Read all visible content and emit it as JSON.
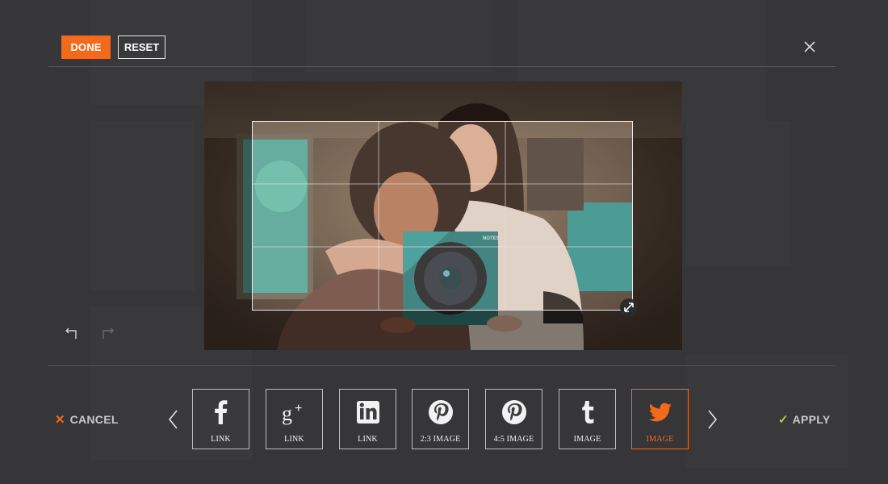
{
  "toolbar": {
    "done_label": "DONE",
    "reset_label": "RESET"
  },
  "icons": {
    "close": "close-icon",
    "undo": "undo-icon",
    "redo": "redo-icon",
    "resize": "resize-handle-icon",
    "prev": "chevron-left-icon",
    "next": "chevron-right-icon"
  },
  "editor": {
    "box_label": "NOTES"
  },
  "share": {
    "items": [
      {
        "label": "LINK",
        "icon": "facebook-icon"
      },
      {
        "label": "LINK",
        "icon": "google-plus-icon"
      },
      {
        "label": "LINK",
        "icon": "linkedin-icon"
      },
      {
        "label": "2:3 IMAGE",
        "icon": "pinterest-icon"
      },
      {
        "label": "4:5 IMAGE",
        "icon": "pinterest-icon"
      },
      {
        "label": "IMAGE",
        "icon": "tumblr-icon"
      },
      {
        "label": "IMAGE",
        "icon": "twitter-icon",
        "selected": true
      }
    ]
  },
  "footer": {
    "cancel_label": "CANCEL",
    "apply_label": "APPLY"
  },
  "colors": {
    "accent": "#f26a1b",
    "apply_check": "#a9cf3a",
    "background": "#3d3d3e"
  }
}
